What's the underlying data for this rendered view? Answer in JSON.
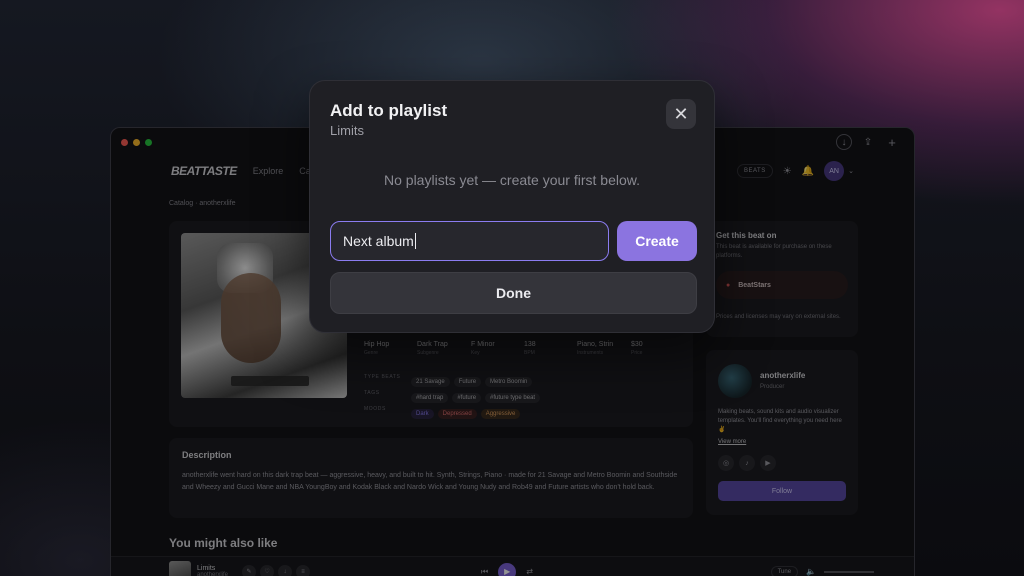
{
  "app": {
    "logo": "BEATTASTE",
    "nav": [
      "Explore",
      "Ca"
    ],
    "beats_pill": "BEATS",
    "avatar_initials": "AN",
    "breadcrumb": "Catalog · anotherxlife"
  },
  "beat": {
    "meta": [
      {
        "value": "Hip Hop",
        "label": "Genre"
      },
      {
        "value": "Dark Trap",
        "label": "Subgenre"
      },
      {
        "value": "F Minor",
        "label": "Key"
      },
      {
        "value": "138",
        "label": "BPM"
      },
      {
        "value": "Piano, Strin",
        "label": "Instruments"
      },
      {
        "value": "$30",
        "label": "Price"
      }
    ],
    "type_beats_label": "TYPE BEATS",
    "type_beats": [
      "21 Savage",
      "Future",
      "Metro Boomin"
    ],
    "tags_label": "TAGS",
    "tags": [
      "#hard trap",
      "#future",
      "#future type beat"
    ],
    "moods_label": "MOODS",
    "moods": [
      "Dark",
      "Depressed",
      "Aggressive"
    ]
  },
  "description": {
    "title": "Description",
    "text": "anotherxlife went hard on this dark trap beat — aggressive, heavy, and built to hit. Synth, Strings, Piano · made for 21 Savage and Metro Boomin and Southside and Wheezy and Gucci Mane and NBA YoungBoy and Kodak Black and Nardo Wick and Young Nudy and Rob49 and Future artists who don't hold back."
  },
  "more_title": "You might also like",
  "purchase": {
    "title": "Get this beat on",
    "subtitle": "This beat is available for purchase on these platforms.",
    "platform": "BeatStars",
    "note": "Prices and licenses may vary on external sites."
  },
  "producer": {
    "name": "anotherxlife",
    "role": "Producer",
    "bio": "Making beats, sound kits and audio visualizer templates. You'll find everything you need here ✌️",
    "view_more": "View more",
    "follow": "Follow"
  },
  "player": {
    "title": "Limits",
    "artist": "anotherxlife",
    "tune": "Tune"
  },
  "modal": {
    "title": "Add to playlist",
    "subtitle": "Limits",
    "empty_message": "No playlists yet — create your first below.",
    "input_value": "Next album",
    "create_label": "Create",
    "done_label": "Done",
    "close_glyph": "✕"
  },
  "colors": {
    "accent": "#8b74e0",
    "input_border": "#8b7cf0",
    "modal_bg": "#1f1f24"
  }
}
